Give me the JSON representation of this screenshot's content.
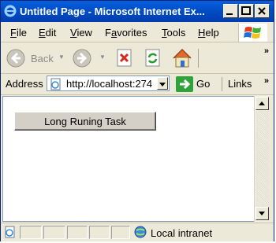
{
  "window": {
    "title": "Untitled Page - Microsoft Internet Ex..."
  },
  "menu": {
    "items": [
      "File",
      "Edit",
      "View",
      "Favorites",
      "Tools",
      "Help"
    ],
    "mnemonics": [
      "F",
      "E",
      "V",
      "a",
      "T",
      "H"
    ]
  },
  "toolbar": {
    "back_label": "Back",
    "icons": [
      "back-icon",
      "forward-icon",
      "stop-icon",
      "refresh-icon",
      "home-icon"
    ]
  },
  "address": {
    "label": "Address",
    "url": "http://localhost:274"
  },
  "go": {
    "label": "Go"
  },
  "links": {
    "label": "Links"
  },
  "content": {
    "button_label": "Long Runing Task"
  },
  "status": {
    "zone": "Local intranet"
  },
  "colors": {
    "titlebar": "#0054e3",
    "go_green": "#2fa33a"
  }
}
